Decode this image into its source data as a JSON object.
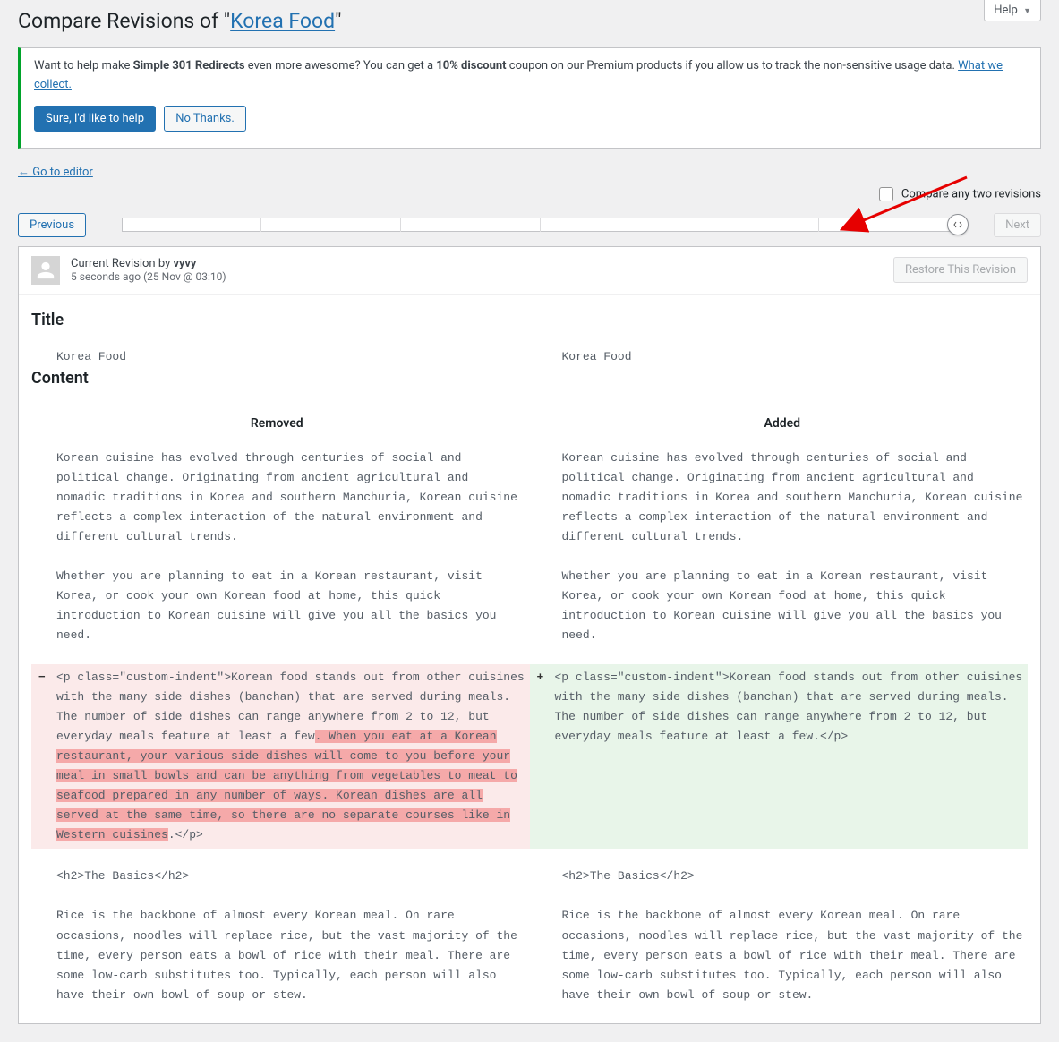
{
  "help_tab": "Help",
  "title_prefix": "Compare Revisions of \"",
  "title_link": "Korea Food",
  "title_suffix": "\"",
  "notice": {
    "text_pre": "Want to help make ",
    "bold1": "Simple 301 Redirects",
    "text_mid": " even more awesome? You can get a ",
    "bold2": "10% discount",
    "text_post": " coupon on our Premium products if you allow us to track the non-sensitive usage data. ",
    "link": "What we collect.",
    "btn_yes": "Sure, I'd like to help",
    "btn_no": "No Thanks."
  },
  "go_editor": "← Go to editor",
  "compare_any": "Compare any two revisions",
  "prev_btn": "Previous",
  "next_btn": "Next",
  "rev_meta": {
    "prefix": "Current Revision by ",
    "author": "vyvy",
    "time_ago": "5 seconds ago ",
    "time_exact": "(25 Nov @ 03:10)"
  },
  "restore_btn": "Restore This Revision",
  "section_title": "Title",
  "title_value": "Korea Food",
  "section_content": "Content",
  "col_removed": "Removed",
  "col_added": "Added",
  "para1": "Korean cuisine has evolved through centuries of social and political change. Originating from ancient agricultural and nomadic traditions in Korea and southern Manchuria, Korean cuisine reflects a complex interaction of the natural environment and different cultural trends.",
  "para2": "Whether you are planning to eat in a Korean restaurant, visit Korea, or cook your own Korean food at home, this quick introduction to Korean cuisine will give you all the basics you need.",
  "diff": {
    "common_pre": "<p class=\"custom-indent\">Korean food stands out from other cuisines with the many side dishes (banchan) that are served during meals. The number of side dishes can range anywhere from 2 to 12, but everyday meals feature at least a few",
    "removed_hl": ". When you eat at a Korean restaurant, your various side dishes will come to you before your meal in small bowls and can be anything from vegetables to meat to seafood prepared in any number of ways. Korean dishes are all served at the same time, so there are no separate courses like in Western cuisines",
    "common_post": ".</p>",
    "added_full": "<p class=\"custom-indent\">Korean food stands out from other cuisines with the many side dishes (banchan) that are served during meals. The number of side dishes can range anywhere from 2 to 12, but everyday meals feature at least a few.</p>"
  },
  "para_basics": "<h2>The Basics</h2>",
  "para_rice": "Rice is the backbone of almost every Korean meal. On rare occasions, noodles will replace rice, but the vast majority of the time, every person eats a bowl of rice with their meal. There are some low-carb substitutes too. Typically, each person will also have their own bowl of soup or stew."
}
